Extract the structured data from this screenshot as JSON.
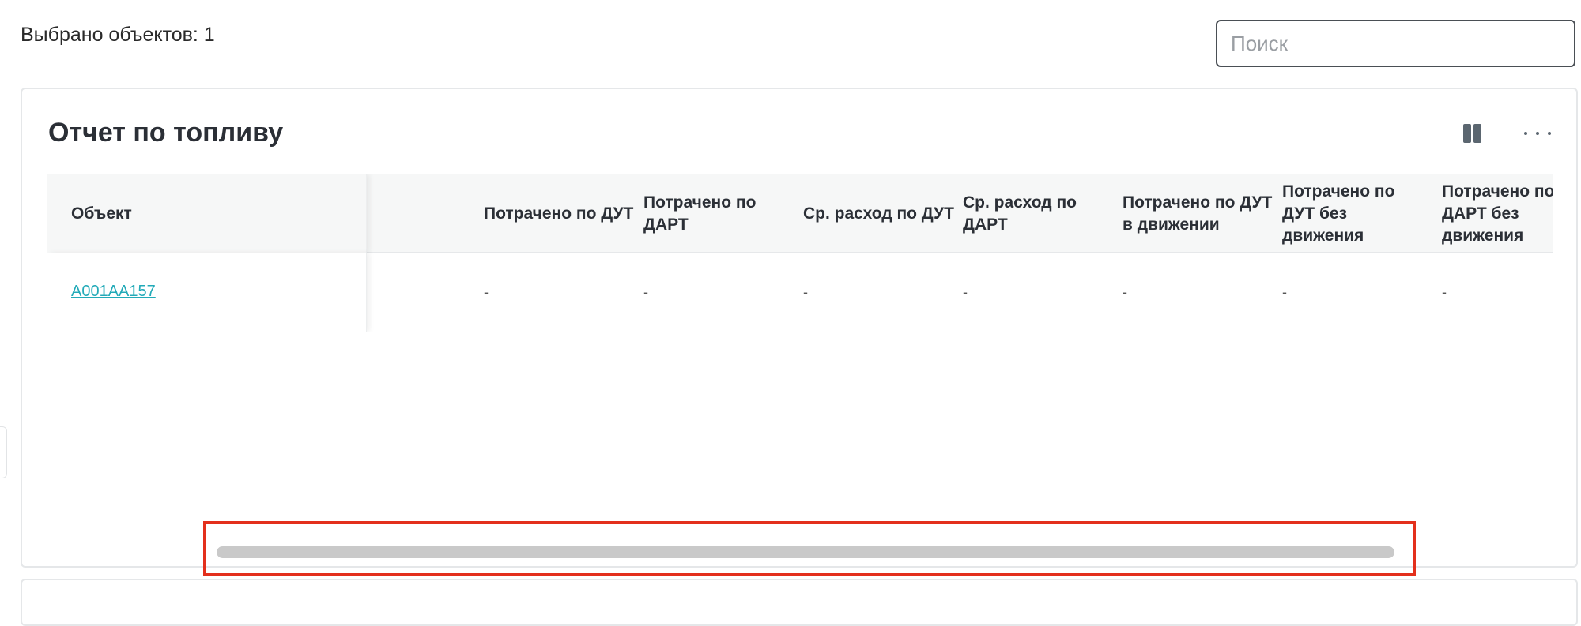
{
  "toolbar": {
    "selected_label": "Выбрано объектов: 1",
    "search_placeholder": "Поиск",
    "search_value": ""
  },
  "report": {
    "title": "Отчет по топливу",
    "columns_icon": "columns-icon",
    "more_icon": "more-horizontal-icon",
    "table": {
      "headers": [
        "Объект",
        "Потрачено по ДУТ",
        "Потрачено по ДАРТ",
        "Ср. расход по ДУТ",
        "Ср. расход по ДАРТ",
        "Потрачено по ДУТ в движении",
        "Потрачено по ДУТ без движения",
        "Потрачено по ДАРТ без движения"
      ],
      "rows": [
        {
          "object": "A001AA157",
          "values": [
            "-",
            "-",
            "-",
            "-",
            "-",
            "-",
            "-"
          ]
        }
      ]
    }
  },
  "colors": {
    "link": "#22aab8",
    "highlight": "#e3301c",
    "scrollbar": "#c9c9c9",
    "header_bg": "#f6f7f7"
  }
}
